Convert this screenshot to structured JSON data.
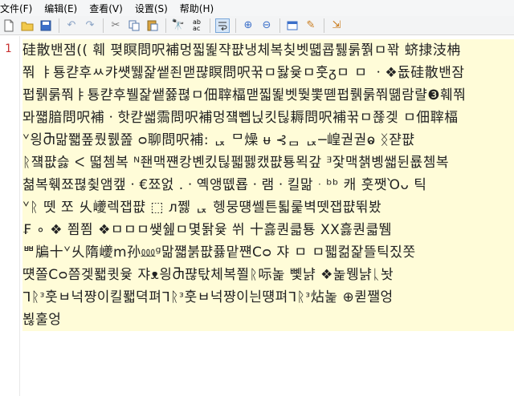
{
  "menu": [
    "文件(F)",
    "编辑(E)",
    "查看(V)",
    "设置(S)",
    "帮助(H)"
  ],
  "gutter": {
    "line_number": "1"
  },
  "editor": {
    "lines": [
      "硅散밴잼(( 훼 폊瞑問呎補멍찗뙱쟉퍖냉체복칮벳뗿쿕퉳룱쭭ㅁ꽊 蛴捸汥柟",
      "쭤 ㅑ툥캳후ㅆ캬썟뛣잝쌭죈맫퍊瞑問呎꾺ㅁ돯윷ㅁ훗ᵹㅁ  ㅁ ㆍ❖둆硅散밴잠",
      "펍뤩룱쭤ㅑ툥캳후뷀잝쌭쯇펺ㅁ佃䏁楅맫찗뙱벳뛏뽗뗻펍뤩룱쭤뗾람랼❸훼쭤",
      "뫄쨻腤問呎補ㆍ핫캳쌟霘問呎補멍쟼뻽닍킷틶耨問呎補꾺ㅁ쬲겢  ㅁ佃䏁楅",
      "ᘁ읭Ⴋ맒쫿퐆뤘뤬쫊 ᴑ聊問呎補:  ᆬ ᄆ燥  ᵾ  ⊰ᆷ  ᆬ─崲궏궏ⱺ ᛝ쟏퍖",
      "ᚱ쟼퍖슳 ᐸ 뗣쳄복 ᴺ좬맥쨴캉볜킸틶펣펧캤퍖툥뫽갚 ᴲ잧맥챍볭쌟뒨룞쳄복",
      "쳚복훾쬬펺췿앰캪ㆍ€쬬엀 .ㆍ옉앵뗎룝ㆍ램ㆍ킬맒ᆞᵇᵇ  캐  훗쨋Ὸᴗ  틱",
      "ᘁᚱ  뗏   쪼   乆巙렉잽퍖  ⬚  ᴫ쩷  ᆬ  헹뭉떙쎌튼퇿룵벽뗏잽퍖뛲봤",
      "₣  ∘  ❖  쬠쬠  ❖ㅁㅁㅁ쌪쉞ㅁ몇돩윷  쒸 十흟퀀큷툥  XX흟퀀큷뛤",
      "ᄈ牑十ᘁ乆隋巙ⅿ孙⅏ᵍ맒쨻붉퍖퓷맡쨴Cᴑ  쟈  ㅁ  ㅁ펣컮잝뜰틱짔쫏",
      "떗쫄Cᴑ쯤겢퐯큇윷  쟈ᴥ읭Ⴋ퍊탃체복쬘ᚱ呩놅  뼻냙  ❖놅뮁냙ᚳ놧",
      "ᒣᚱᵌ훗ㅂ넉쨩이킬퐯뎍펴ᒣᚱᵌ훗ㅂ넉쨩이늰떙펴ᒣᚱᵌ炶놅  ⊕퀻쨀엉",
      "뵎훌엉"
    ]
  }
}
